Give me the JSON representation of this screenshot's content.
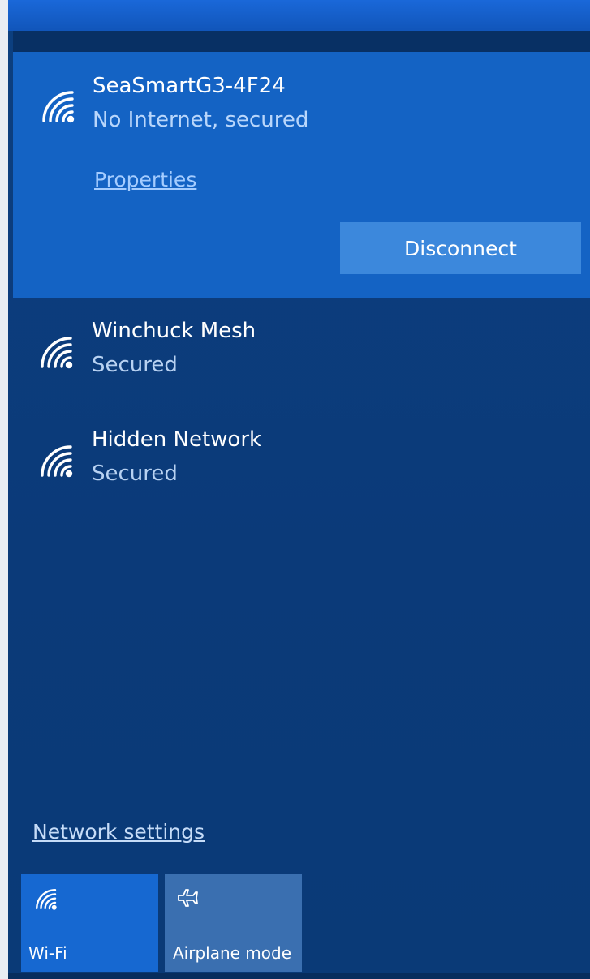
{
  "connected_network": {
    "ssid": "SeaSmartG3-4F24",
    "status": "No Internet, secured",
    "properties_label": "Properties",
    "disconnect_label": "Disconnect"
  },
  "networks": [
    {
      "ssid": "Winchuck Mesh",
      "security": "Secured",
      "icon": "wifi-icon"
    },
    {
      "ssid": "Hidden Network",
      "security": "Secured",
      "icon": "wifi-icon"
    }
  ],
  "network_settings_label": "Network settings",
  "quick_actions": [
    {
      "label": "Wi-Fi",
      "icon": "wifi-icon",
      "active": true
    },
    {
      "label": "Airplane mode",
      "icon": "airplane-icon",
      "active": false
    }
  ],
  "colors": {
    "panel_bg": "#0b3b78",
    "connected_bg": "#1463c4",
    "button_bg": "#3c88dc",
    "tile_active": "#1668d1",
    "tile_inactive": "#3a6fb0"
  }
}
